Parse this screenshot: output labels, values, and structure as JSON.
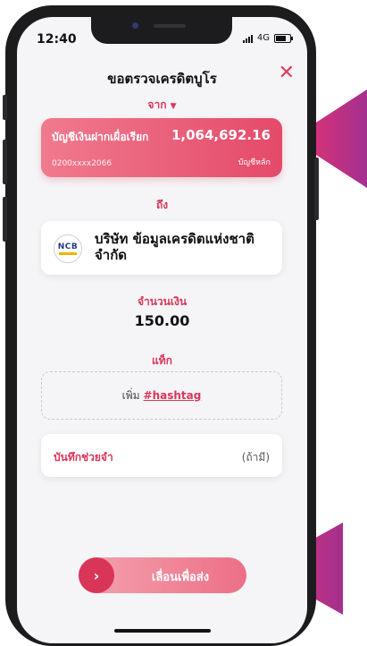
{
  "status": {
    "time": "12:40",
    "network": "4G"
  },
  "header": {
    "title": "ขอตรวจเครดิตบูโร",
    "close_icon": "close-icon"
  },
  "from_section": {
    "label": "จาก",
    "account": {
      "name": "บัญชีเงินฝากเผื่อเรียก",
      "balance": "1,064,692.16",
      "number": "0200xxxx2066",
      "tag": "บัญชีหลัก"
    }
  },
  "to_section": {
    "label": "ถึง",
    "recipient": {
      "logo_text": "NCB",
      "name": "บริษัท ข้อมูลเครดิตแห่งชาติ จำกัด"
    }
  },
  "amount_section": {
    "label": "จำนวนเงิน",
    "value": "150.00"
  },
  "tag_section": {
    "label": "แท็ก",
    "add_prefix": "เพิ่ม",
    "hashtag": "#hashtag"
  },
  "memo_section": {
    "label": "บันทึกช่วยจำ",
    "optional": "(ถ้ามี)"
  },
  "slide_button": {
    "label": "เลื่อนเพื่อส่ง",
    "knob_icon": "chevron-right-icon"
  },
  "colors": {
    "accent": "#d93559",
    "card_start": "#f07a8e",
    "card_end": "#e44a6a"
  }
}
